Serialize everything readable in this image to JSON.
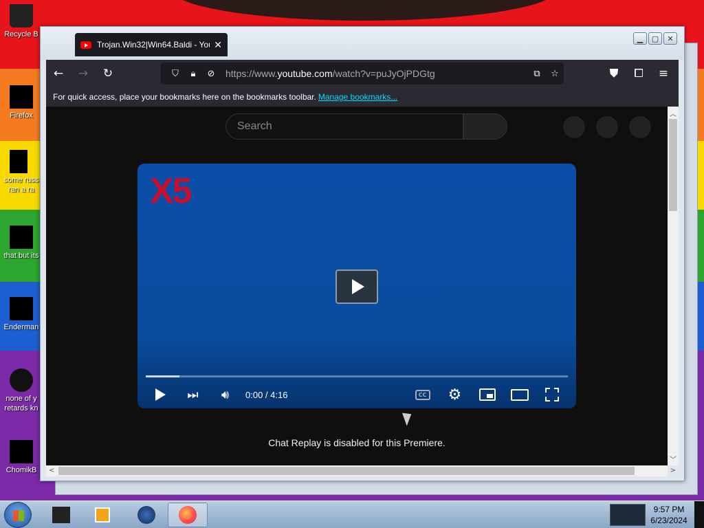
{
  "desktop": {
    "icons": [
      {
        "label": "Recycle B",
        "icon": "recycle-bin-icon"
      },
      {
        "label": "Firefox",
        "icon": "firefox-icon"
      },
      {
        "label": "some russ",
        "label2": "ran a ra",
        "icon": "file-icon"
      },
      {
        "label": "that but its",
        "icon": "folder-icon"
      },
      {
        "label": "Enderman",
        "icon": "app-icon"
      },
      {
        "label": "none of y",
        "label2": "retards kn",
        "icon": "file-icon"
      },
      {
        "label": "ChomikB",
        "icon": "app-icon"
      }
    ]
  },
  "browser": {
    "tab_title": "Trojan.Win32|Win64.Baldi - You",
    "tab_close": "✕",
    "url_prefix": "https://www.",
    "url_host": "youtube.com",
    "url_path": "/watch?v=puJyOjPDGtg",
    "bookmarks_text": "For quick access, place your bookmarks here on the bookmarks toolbar.",
    "bookmarks_link": "Manage bookmarks...",
    "window_buttons": {
      "minimize": "▁",
      "maximize": "▢",
      "close": "✕"
    }
  },
  "youtube": {
    "search_placeholder": "Search",
    "video_overlay_text": "X5",
    "time_display": "0:00 / 4:16",
    "progress": 0.08,
    "cc_label": "CC",
    "chat_message": "Chat Replay is disabled for this Premiere."
  },
  "taskbar": {
    "time": "9:57 PM",
    "date": "6/23/2024"
  },
  "colors": {
    "youtube_bg": "#0f0f0f",
    "browser_chrome": "#2b2a33",
    "link": "#00ddff",
    "video_blue": "#0a4ea8",
    "overlay_red": "#c8102e"
  }
}
